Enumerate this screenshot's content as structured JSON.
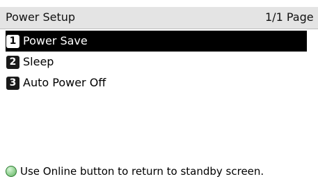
{
  "header": {
    "title": "Power Setup",
    "page_indicator": "1/1 Page"
  },
  "menu": {
    "items": [
      {
        "number": "1",
        "label": "Power Save",
        "selected": true
      },
      {
        "number": "2",
        "label": "Sleep",
        "selected": false
      },
      {
        "number": "3",
        "label": "Auto Power Off",
        "selected": false
      }
    ]
  },
  "footer": {
    "icon": "online-button-icon",
    "icon_color": "#7cc47c",
    "hint": "Use Online button to return to standby screen."
  },
  "colors": {
    "header_background": "#e4e4e4",
    "selection_background": "#000000",
    "selection_text": "#ffffff"
  }
}
